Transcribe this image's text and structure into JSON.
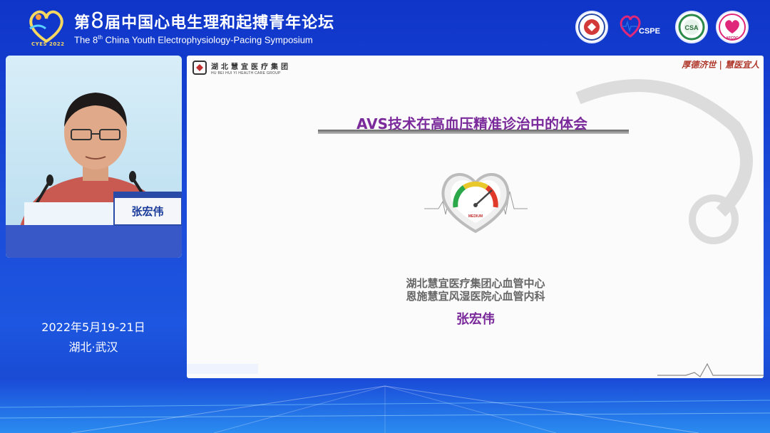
{
  "header": {
    "logo_text": "CYES 2022",
    "title_cn_prefix": "第",
    "title_cn_number": "8",
    "title_cn_suffix": "届中国心电生理和起搏青年论坛",
    "title_en_prefix": "The 8",
    "title_en_sup": "th",
    "title_en_suffix": " China Youth Electrophysiology-Pacing Symposium",
    "org_logos": [
      "society-emblem-red",
      "cspe-logo",
      "csa-logo",
      "afcdc-logo"
    ],
    "cspe_label": "CSPE",
    "csa_label": "CSA",
    "afcdc_label": "AFCDC"
  },
  "speaker_video": {
    "nameplate": "张宏伟"
  },
  "event": {
    "date": "2022年5月19-21日",
    "place": "湖北·武汉"
  },
  "slide": {
    "company_cn": "湖北慧宜医疗集团",
    "company_en": "HU BEI HUI YI HEALTH CARE GROUP",
    "motto": "厚德济世 | 慧医宜人",
    "title": "AVS技术在高血压精准诊治中的体会",
    "affiliation_1": "湖北慧宜医疗集团心血管中心",
    "affiliation_2": "恩施慧宜风湿医院心血管内科",
    "speaker": "张宏伟",
    "gauge_label": "MEDIUM"
  },
  "colors": {
    "background": "#1a4ad8",
    "slide_title": "#7a2a9a",
    "motto": "#b03a2e"
  }
}
